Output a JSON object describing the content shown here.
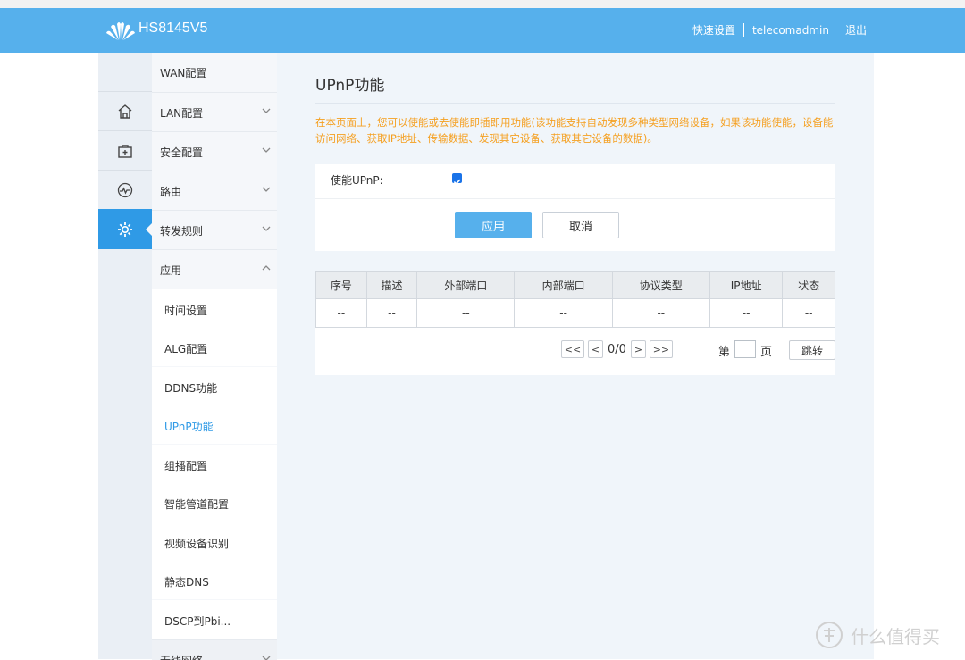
{
  "colors": {
    "header_bg": "#56b0ec",
    "active_blue": "#2f9ae6",
    "notice_orange": "#f5a021",
    "content_bg": "#f0f5fa"
  },
  "header": {
    "model": "HS8145V5",
    "quick_setup": "快速设置",
    "user": "telecomadmin",
    "logout": "退出"
  },
  "icon_bar": [
    {
      "icon": "home-icon"
    },
    {
      "icon": "first-aid-kit-icon"
    },
    {
      "icon": "pulse-icon"
    },
    {
      "icon": "gear-icon",
      "active": true
    }
  ],
  "sidebar": {
    "items": [
      {
        "label": "WAN配置"
      },
      {
        "label": "LAN配置",
        "expandable": true
      },
      {
        "label": "安全配置",
        "expandable": true
      },
      {
        "label": "路由",
        "expandable": true
      },
      {
        "label": "转发规则",
        "expandable": true
      },
      {
        "label": "应用",
        "expanded": true
      }
    ],
    "sub_items": [
      {
        "label": "时间设置"
      },
      {
        "label": "ALG配置"
      },
      {
        "label": "DDNS功能"
      },
      {
        "label": "UPnP功能",
        "active": true
      },
      {
        "label": "组播配置"
      },
      {
        "label": "智能管道配置"
      },
      {
        "label": "视频设备识别"
      },
      {
        "label": "静态DNS"
      },
      {
        "label": "DSCP到Pbi..."
      }
    ],
    "next_item": "无线网络"
  },
  "main": {
    "title": "UPnP功能",
    "notice": "在本页面上，您可以使能或去使能即插即用功能(该功能支持自动发现多种类型网络设备，如果该功能使能，设备能访问网络、获取IP地址、传输数据、发现其它设备、获取其它设备的数据)。",
    "form": {
      "enable_label": "使能UPnP:",
      "enabled": true,
      "apply_label": "应用",
      "cancel_label": "取消"
    },
    "table": {
      "headers": [
        "序号",
        "描述",
        "外部端口",
        "内部端口",
        "协议类型",
        "IP地址",
        "状态"
      ],
      "rows": [
        [
          "--",
          "--",
          "--",
          "--",
          "--",
          "--",
          "--"
        ]
      ]
    },
    "pager": {
      "first": "<<",
      "prev": "<",
      "info": "0/0",
      "next": ">",
      "last": ">>",
      "page_prefix": "第",
      "page_suffix": "页",
      "jump": "跳转"
    }
  },
  "watermark": "什么值得买"
}
